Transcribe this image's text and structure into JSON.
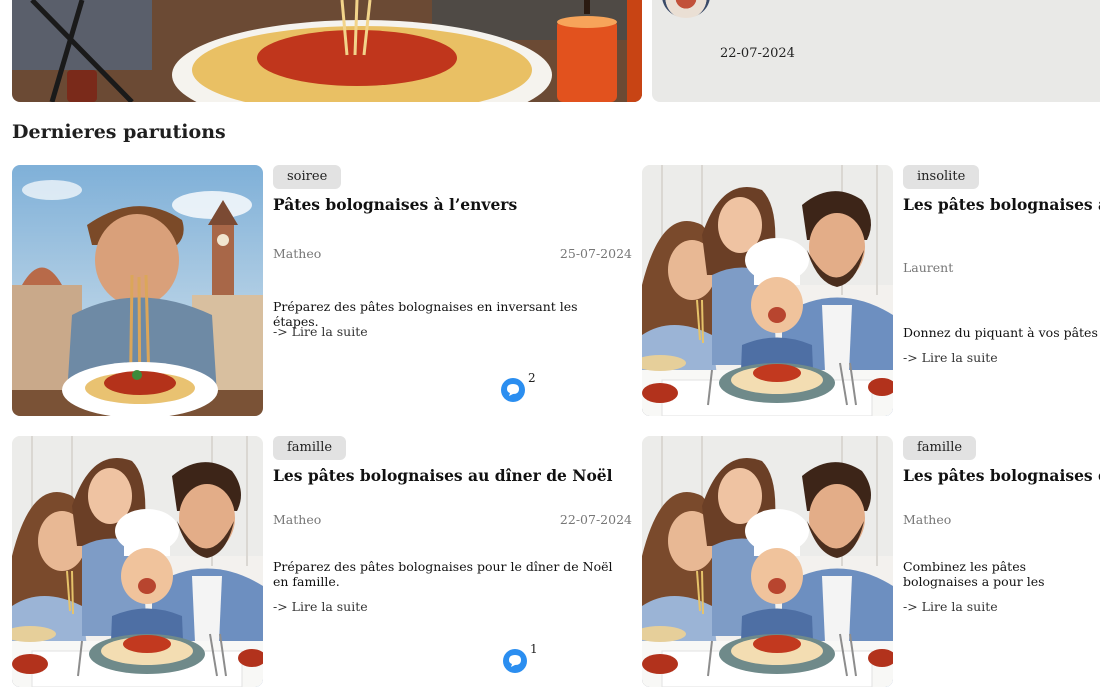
{
  "hero": {
    "date": "22-07-2024"
  },
  "section_title": "Dernieres parutions",
  "cards": [
    {
      "tag": "soiree",
      "title": "Pâtes bolognaises à l’envers",
      "author": "Matheo",
      "date": "25-07-2024",
      "excerpt": "Préparez des pâtes bolognaises en inversant les étapes.",
      "read_more": "-> Lire la suite",
      "comments": "2"
    },
    {
      "tag": "insolite",
      "title": "Les pâtes bolognaises aux",
      "author": "Laurent",
      "excerpt": "Donnez du piquant à vos pâtes bo",
      "read_more": "-> Lire la suite"
    },
    {
      "tag": "famille",
      "title": "Les pâtes bolognaises au dîner de Noël",
      "author": "Matheo",
      "date": "22-07-2024",
      "excerpt": "Préparez des pâtes bolognaises pour le dîner de Noël en famille.",
      "read_more": "-> Lire la suite",
      "comments": "1"
    },
    {
      "tag": "famille",
      "title": "Les pâtes bolognaises et la",
      "author": "Matheo",
      "excerpt": "Combinez les pâtes bolognaises a pour les enfants.",
      "read_more": "-> Lire la suite"
    }
  ],
  "colors": {
    "comment_icon": "#2b8ef0",
    "tag_bg": "#e2e2e2",
    "hero_side_bg": "#e9e9e7"
  },
  "icons": {
    "comment": "speech-bubble-icon"
  }
}
